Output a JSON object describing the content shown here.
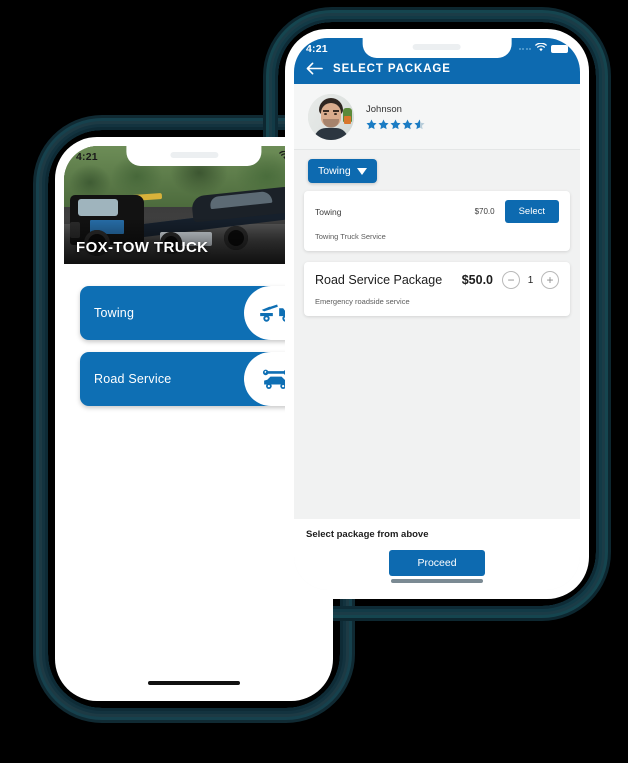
{
  "left_phone": {
    "status_bar": {
      "time": "4:21",
      "wifi_icon": "wifi-icon",
      "battery_icon": "battery-icon"
    },
    "hero": {
      "title": "FOX-TOW TRUCK",
      "image_alt": "tow-truck-photo"
    },
    "services": [
      {
        "label": "Towing",
        "icon": "tow-truck-icon"
      },
      {
        "label": "Road Service",
        "icon": "car-wrench-icon"
      }
    ],
    "home_indicator": "home-indicator"
  },
  "right_phone": {
    "status_bar": {
      "time": "4:21",
      "signal_icon": "signal-dots-icon",
      "wifi_icon": "wifi-icon",
      "battery_icon": "battery-icon"
    },
    "appbar": {
      "back_icon": "back-arrow-icon",
      "title": "SELECT PACKAGE"
    },
    "profile": {
      "name": "Johnson",
      "avatar": "provider-avatar",
      "rating": 4.5,
      "stars_total": 5
    },
    "filter": {
      "label": "Towing",
      "caret_icon": "caret-down-icon"
    },
    "packages": [
      {
        "name": "Towing",
        "price": "$70.0",
        "description": "Towing Truck Service",
        "action": "select",
        "action_label": "Select"
      },
      {
        "name": "Road Service Package",
        "price": "$50.0",
        "description": "Emergency roadside service",
        "action": "stepper",
        "minus_label": "−",
        "quantity": "1",
        "plus_label": "+"
      }
    ],
    "bottom": {
      "hint": "Select package from above",
      "proceed_label": "Proceed"
    },
    "home_indicator": "home-indicator"
  },
  "colors": {
    "brand_blue": "#0d6ab0",
    "card_blue": "#0e6fb4",
    "app_bg": "#f1f2f2",
    "page_bg": "#000000",
    "star": "#1b7cc4",
    "halo": "#16414d"
  }
}
